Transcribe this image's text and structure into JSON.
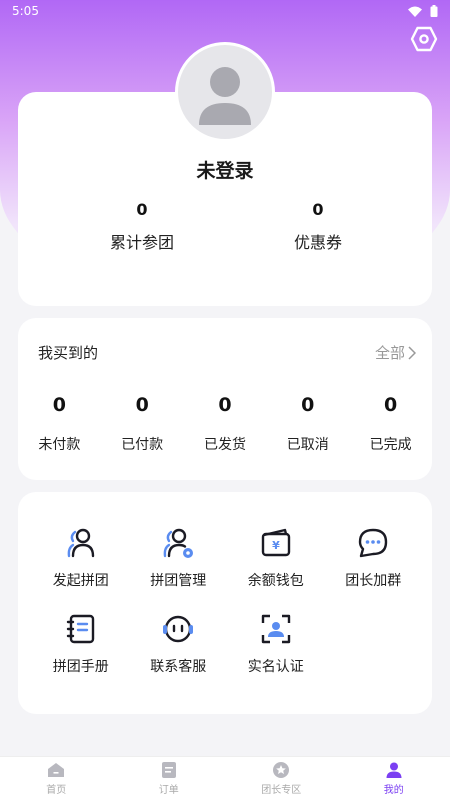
{
  "status_bar": {
    "time": "5:05"
  },
  "profile": {
    "login_status": "未登录",
    "stats": [
      {
        "value": "0",
        "label": "累计参团"
      },
      {
        "value": "0",
        "label": "优惠券"
      }
    ]
  },
  "orders": {
    "title": "我买到的",
    "all_label": "全部",
    "items": [
      {
        "value": "0",
        "label": "未付款"
      },
      {
        "value": "0",
        "label": "已付款"
      },
      {
        "value": "0",
        "label": "已发货"
      },
      {
        "value": "0",
        "label": "已取消"
      },
      {
        "value": "0",
        "label": "已完成"
      }
    ]
  },
  "services": [
    {
      "label": "发起拼团",
      "icon": "user-group-icon"
    },
    {
      "label": "拼团管理",
      "icon": "user-gear-icon"
    },
    {
      "label": "余额钱包",
      "icon": "wallet-icon"
    },
    {
      "label": "团长加群",
      "icon": "chat-bubble-icon"
    },
    {
      "label": "拼团手册",
      "icon": "notebook-icon"
    },
    {
      "label": "联系客服",
      "icon": "headset-icon"
    },
    {
      "label": "实名认证",
      "icon": "id-scan-icon"
    }
  ],
  "tabs": [
    {
      "label": "首页",
      "icon": "home-icon"
    },
    {
      "label": "订单",
      "icon": "order-icon"
    },
    {
      "label": "团长专区",
      "icon": "star-badge-icon"
    },
    {
      "label": "我的",
      "icon": "person-icon",
      "active": true
    }
  ],
  "colors": {
    "accent": "#7b3ff2",
    "gradient_top": "#b168f5",
    "icon_blue": "#5a8cf0"
  }
}
